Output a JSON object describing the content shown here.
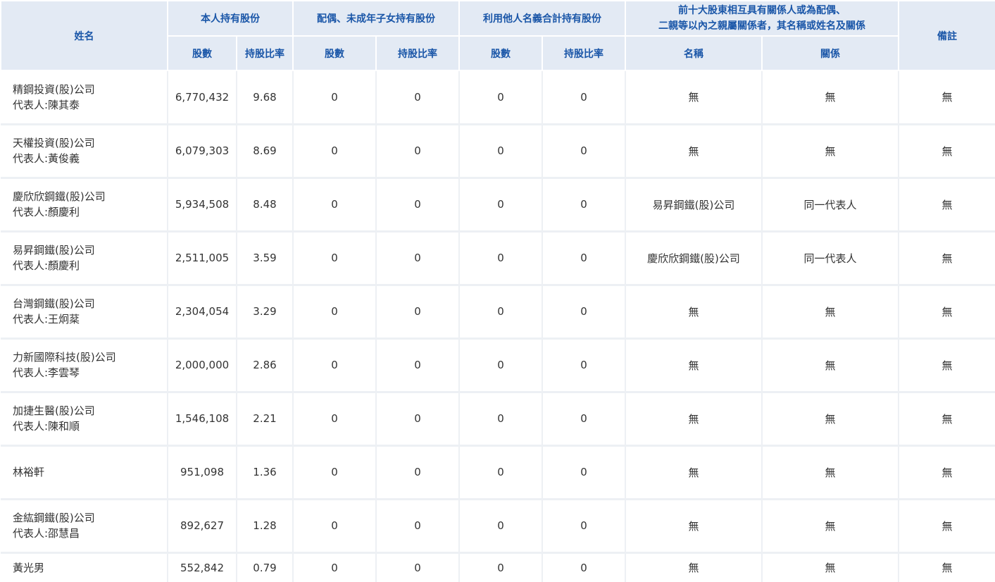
{
  "header": {
    "name": "姓名",
    "self_holding": "本人持有股份",
    "spouse_holding": "配偶、未成年子女持有股份",
    "nominee_holding": "利用他人名義合計持有股份",
    "related_line1": "前十大股東相互具有關係人或為配偶、",
    "related_line2": "二親等以內之親屬關係者，其名稱或姓名及關係",
    "remark": "備註",
    "sub": {
      "self_shares": "股數",
      "self_ratio": "持股比率",
      "spouse_shares": "股數",
      "spouse_ratio": "持股比率",
      "nominee_shares": "股數",
      "nominee_ratio": "持股比率",
      "related_name": "名稱",
      "related_relation": "關係"
    }
  },
  "rows": [
    {
      "name": "精鋼投資(股)公司",
      "rep": "代表人:陳其泰",
      "shares": "6,770,432",
      "ratio": "9.68",
      "spouse_shares": "0",
      "spouse_ratio": "0",
      "nominee_shares": "0",
      "nominee_ratio": "0",
      "related_name": "無",
      "relation": "無",
      "remark": "無"
    },
    {
      "name": "天權投資(股)公司",
      "rep": "代表人:黃俊義",
      "shares": "6,079,303",
      "ratio": "8.69",
      "spouse_shares": "0",
      "spouse_ratio": "0",
      "nominee_shares": "0",
      "nominee_ratio": "0",
      "related_name": "無",
      "relation": "無",
      "remark": "無"
    },
    {
      "name": "慶欣欣鋼鐵(股)公司",
      "rep": "代表人:顏慶利",
      "shares": "5,934,508",
      "ratio": "8.48",
      "spouse_shares": "0",
      "spouse_ratio": "0",
      "nominee_shares": "0",
      "nominee_ratio": "0",
      "related_name": "易昇鋼鐵(股)公司",
      "relation": "同一代表人",
      "remark": "無"
    },
    {
      "name": "易昇鋼鐵(股)公司",
      "rep": "代表人:顏慶利",
      "shares": "2,511,005",
      "ratio": "3.59",
      "spouse_shares": "0",
      "spouse_ratio": "0",
      "nominee_shares": "0",
      "nominee_ratio": "0",
      "related_name": "慶欣欣鋼鐵(股)公司",
      "relation": "同一代表人",
      "remark": "無"
    },
    {
      "name": "台灣鋼鐵(股)公司",
      "rep": "代表人:王炯棻",
      "shares": "2,304,054",
      "ratio": "3.29",
      "spouse_shares": "0",
      "spouse_ratio": "0",
      "nominee_shares": "0",
      "nominee_ratio": "0",
      "related_name": "無",
      "relation": "無",
      "remark": "無"
    },
    {
      "name": "力新國際科技(股)公司",
      "rep": "代表人:李雲琴",
      "shares": "2,000,000",
      "ratio": "2.86",
      "spouse_shares": "0",
      "spouse_ratio": "0",
      "nominee_shares": "0",
      "nominee_ratio": "0",
      "related_name": "無",
      "relation": "無",
      "remark": "無"
    },
    {
      "name": "加捷生醫(股)公司",
      "rep": "代表人:陳和順",
      "shares": "1,546,108",
      "ratio": "2.21",
      "spouse_shares": "0",
      "spouse_ratio": "0",
      "nominee_shares": "0",
      "nominee_ratio": "0",
      "related_name": "無",
      "relation": "無",
      "remark": "無"
    },
    {
      "name": "林裕軒",
      "rep": "",
      "shares": "951,098",
      "ratio": "1.36",
      "spouse_shares": "0",
      "spouse_ratio": "0",
      "nominee_shares": "0",
      "nominee_ratio": "0",
      "related_name": "無",
      "relation": "無",
      "remark": "無"
    },
    {
      "name": "金紘鋼鐵(股)公司",
      "rep": "代表人:邵慧昌",
      "shares": "892,627",
      "ratio": "1.28",
      "spouse_shares": "0",
      "spouse_ratio": "0",
      "nominee_shares": "0",
      "nominee_ratio": "0",
      "related_name": "無",
      "relation": "無",
      "remark": "無"
    },
    {
      "name": "黃光男",
      "rep": "",
      "shares": "552,842",
      "ratio": "0.79",
      "spouse_shares": "0",
      "spouse_ratio": "0",
      "nominee_shares": "0",
      "nominee_ratio": "0",
      "related_name": "無",
      "relation": "無",
      "remark": "無"
    }
  ]
}
